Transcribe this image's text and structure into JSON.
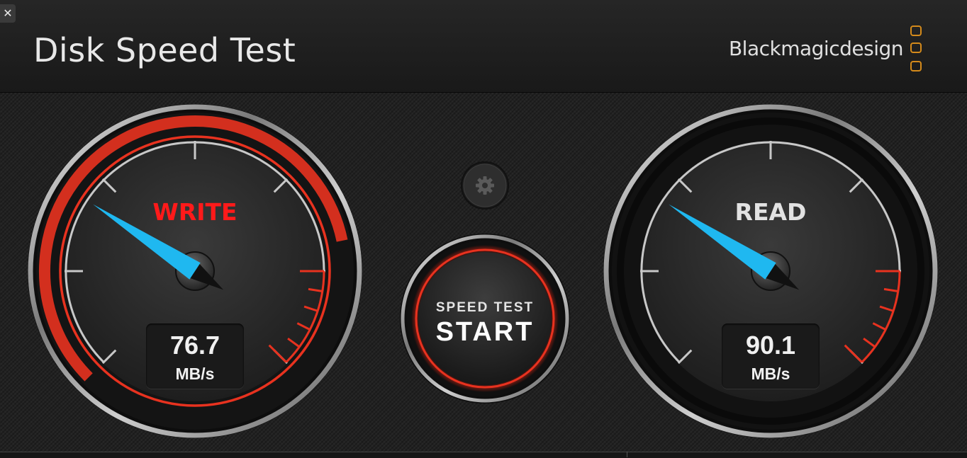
{
  "window": {
    "close_glyph": "✕",
    "title": "Disk Speed Test",
    "brand": "Blackmagicdesign"
  },
  "settings_button": {
    "icon": "gear-icon"
  },
  "start_button": {
    "line1": "SPEED TEST",
    "line2": "START"
  },
  "write_gauge": {
    "label": "WRITE",
    "value": "76.7",
    "unit": "MB/s",
    "needle_fraction": 0.29,
    "progress_fraction": 0.79,
    "label_color": "#ff1a1a"
  },
  "read_gauge": {
    "label": "READ",
    "value": "90.1",
    "unit": "MB/s",
    "needle_fraction": 0.29,
    "label_color": "#e2e2e2"
  },
  "colors": {
    "needle": "#1fb8f0",
    "ring_red": "#e8321f",
    "brand_orange": "#d48a1b"
  }
}
